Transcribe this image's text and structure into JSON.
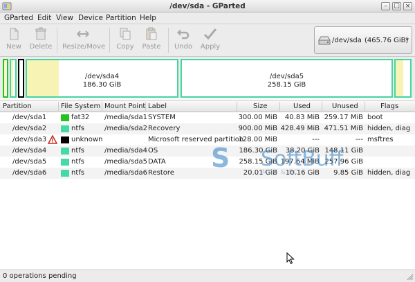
{
  "window": {
    "title": "/dev/sda - GParted",
    "buttons": [
      "minimize",
      "maximize",
      "close"
    ]
  },
  "menu": [
    "GParted",
    "Edit",
    "View",
    "Device",
    "Partition",
    "Help"
  ],
  "toolbar": {
    "new_label": "New",
    "delete_label": "Delete",
    "resize_label": "Resize/Move",
    "copy_label": "Copy",
    "paste_label": "Paste",
    "undo_label": "Undo",
    "apply_label": "Apply"
  },
  "device": {
    "name": "/dev/sda",
    "size": "(465.76 GiB)"
  },
  "diskmap": {
    "sda4": {
      "name": "/dev/sda4",
      "size": "186.30 GiB",
      "used_fraction": 0.21
    },
    "sda5": {
      "name": "/dev/sda5",
      "size": "258.15 GiB",
      "used_fraction": 0.0
    }
  },
  "table": {
    "columns": [
      "Partition",
      "File System",
      "Mount Point",
      "Label",
      "Size",
      "Used",
      "Unused",
      "Flags"
    ],
    "rows": [
      {
        "partition": "/dev/sda1",
        "fs": "fat32",
        "fs_color": "#21c421",
        "mount": "/media/sda1",
        "label": "SYSTEM",
        "size": "300.00 MiB",
        "used": "40.83 MiB",
        "unused": "259.17 MiB",
        "flags": "boot",
        "warning": false
      },
      {
        "partition": "/dev/sda2",
        "fs": "ntfs",
        "fs_color": "#45d9a6",
        "mount": "/media/sda2",
        "label": "Recovery",
        "size": "900.00 MiB",
        "used": "428.49 MiB",
        "unused": "471.51 MiB",
        "flags": "hidden, diag",
        "warning": false
      },
      {
        "partition": "/dev/sda3",
        "fs": "unknown",
        "fs_color": "#000000",
        "mount": "",
        "label": "Microsoft reserved partition",
        "size": "128.00 MiB",
        "used": "---",
        "unused": "---",
        "flags": "msftres",
        "warning": true
      },
      {
        "partition": "/dev/sda4",
        "fs": "ntfs",
        "fs_color": "#45d9a6",
        "mount": "/media/sda4",
        "label": "OS",
        "size": "186.30 GiB",
        "used": "38.20 GiB",
        "unused": "148.11 GiB",
        "flags": "",
        "warning": false
      },
      {
        "partition": "/dev/sda5",
        "fs": "ntfs",
        "fs_color": "#45d9a6",
        "mount": "/media/sda5",
        "label": "DATA",
        "size": "258.15 GiB",
        "used": "197.64 MiB",
        "unused": "257.96 GiB",
        "flags": "",
        "warning": false
      },
      {
        "partition": "/dev/sda6",
        "fs": "ntfs",
        "fs_color": "#45d9a6",
        "mount": "/media/sda6",
        "label": "Restore",
        "size": "20.01 GiB",
        "used": "10.16 GiB",
        "unused": "9.85 GiB",
        "flags": "hidden, diag",
        "warning": false
      }
    ]
  },
  "watermark": {
    "logo": "S",
    "name": "SoftBuff",
    "sub": "MAC & PC"
  },
  "status": {
    "text": "0 operations pending"
  }
}
